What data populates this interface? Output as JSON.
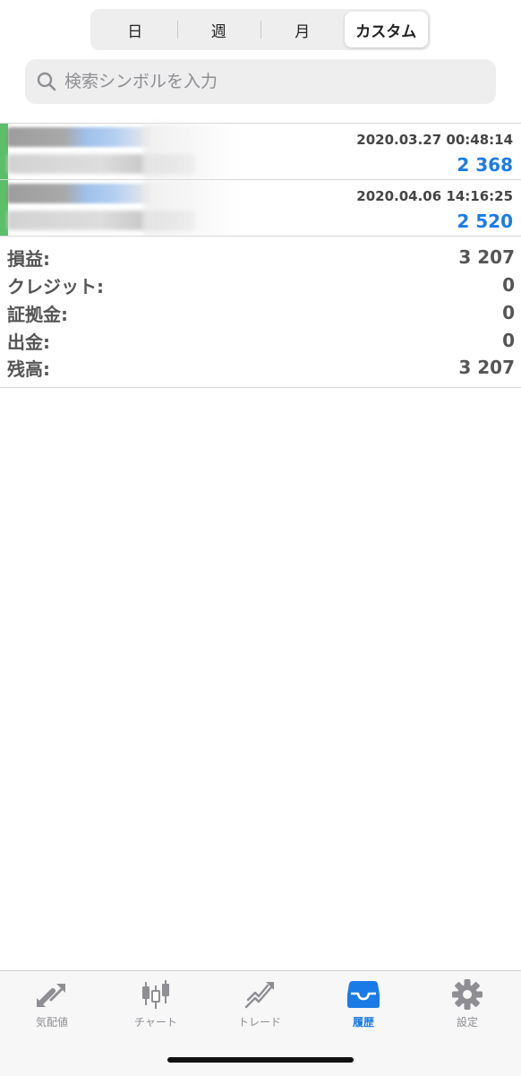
{
  "segments": [
    {
      "label": "日",
      "active": false
    },
    {
      "label": "週",
      "active": false
    },
    {
      "label": "月",
      "active": false
    },
    {
      "label": "カスタム",
      "active": true
    }
  ],
  "search": {
    "placeholder": "検索シンボルを入力",
    "value": ""
  },
  "deals": [
    {
      "time": "2020.03.27 00:48:14",
      "profit": "2 368"
    },
    {
      "time": "2020.04.06 14:16:25",
      "profit": "2 520"
    }
  ],
  "summary": [
    {
      "label": "損益:",
      "value": "3 207"
    },
    {
      "label": "クレジット:",
      "value": "0"
    },
    {
      "label": "証拠金:",
      "value": "0"
    },
    {
      "label": "出金:",
      "value": "0"
    },
    {
      "label": "残高:",
      "value": "3 207"
    }
  ],
  "tabs": [
    {
      "label": "気配値",
      "icon": "quotes-icon",
      "active": false
    },
    {
      "label": "チャート",
      "icon": "candlestick-chart-icon",
      "active": false
    },
    {
      "label": "トレード",
      "icon": "trade-icon",
      "active": false
    },
    {
      "label": "履歴",
      "icon": "history-inbox-icon",
      "active": true
    },
    {
      "label": "設定",
      "icon": "gear-icon",
      "active": false
    }
  ],
  "colors": {
    "accent": "#1a7be6",
    "buy_strip": "#3fb34f",
    "inactive_icon": "#8e8e93"
  }
}
